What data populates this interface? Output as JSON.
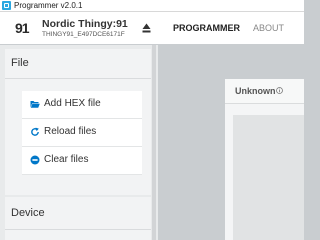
{
  "window": {
    "title": "Programmer v2.0.1"
  },
  "header": {
    "logo_text": "91",
    "device_name": "Nordic Thingy:91",
    "device_serial": "THINGY91_E497DCE6171F",
    "nav": {
      "programmer": "PROGRAMMER",
      "about": "ABOUT"
    }
  },
  "sidebar": {
    "file_panel": {
      "title": "File",
      "actions": [
        {
          "label": "Add HEX file",
          "icon": "folder-open-icon"
        },
        {
          "label": "Reload files",
          "icon": "reload-icon"
        },
        {
          "label": "Clear files",
          "icon": "minus-circle-icon"
        }
      ]
    },
    "device_panel": {
      "title": "Device"
    }
  },
  "main": {
    "memory_card": {
      "title": "Unknown",
      "icon": "info-icon"
    }
  },
  "colors": {
    "accent": "#2ba7e0",
    "icon_blue": "#0077c8",
    "sidebar_bg": "#e8eaeb",
    "main_bg": "#c9cdd0"
  }
}
